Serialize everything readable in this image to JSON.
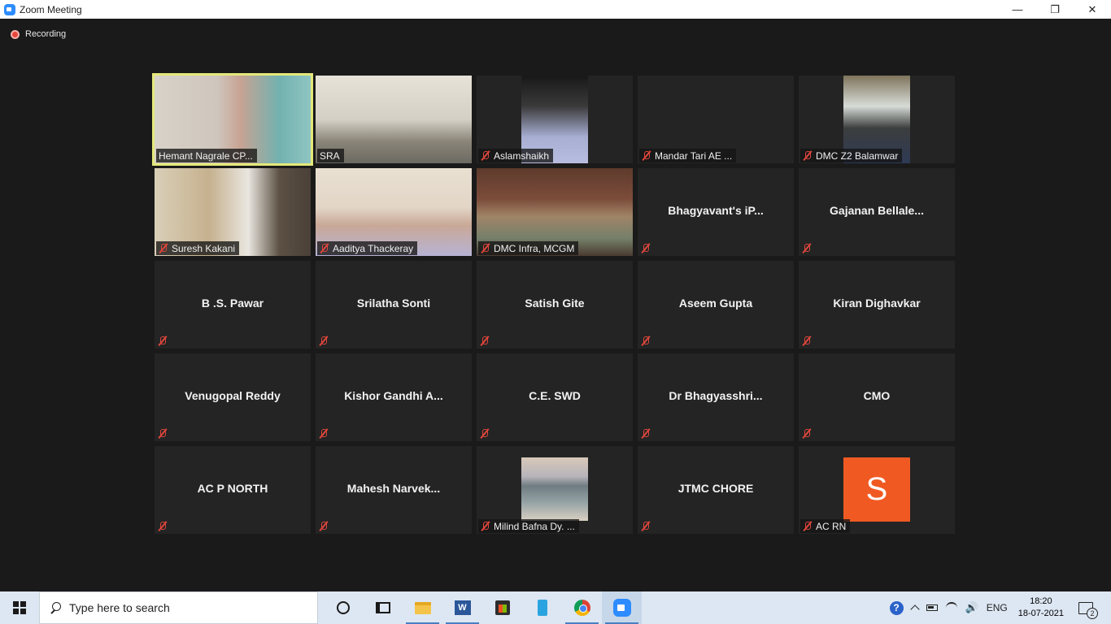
{
  "window": {
    "title": "Zoom Meeting",
    "minimize": "—",
    "restore": "❐",
    "close": "✕"
  },
  "recording": {
    "label": "Recording"
  },
  "participants": [
    {
      "name": "Hemant Nagrale CP...",
      "video": "hemant",
      "muted": false,
      "active": true
    },
    {
      "name": "SRA",
      "video": "sra",
      "muted": false
    },
    {
      "name": "Aslamshaikh",
      "video": "aslam",
      "muted": true
    },
    {
      "name": "Mandar Tari AE ...",
      "video": "none-tag",
      "muted": true
    },
    {
      "name": "DMC Z2 Balamwar",
      "video": "dmcz2",
      "muted": true
    },
    {
      "name": "Suresh Kakani",
      "video": "suresh",
      "muted": true
    },
    {
      "name": "Aaditya Thackeray",
      "video": "aaditya",
      "muted": true
    },
    {
      "name": "DMC Infra, MCGM",
      "video": "dmcinfra",
      "muted": true
    },
    {
      "name": "Bhagyavant's  iP...",
      "video": "none",
      "muted": true
    },
    {
      "name": "Gajanan  Bellale...",
      "video": "none",
      "muted": true
    },
    {
      "name": "B .S. Pawar",
      "video": "none",
      "muted": true
    },
    {
      "name": "Srilatha Sonti",
      "video": "none",
      "muted": true
    },
    {
      "name": "Satish Gite",
      "video": "none",
      "muted": true
    },
    {
      "name": "Aseem Gupta",
      "video": "none",
      "muted": true
    },
    {
      "name": "Kiran Dighavkar",
      "video": "none",
      "muted": true
    },
    {
      "name": "Venugopal Reddy",
      "video": "none",
      "muted": true
    },
    {
      "name": "Kishor Gandhi A...",
      "video": "none",
      "muted": true
    },
    {
      "name": "C.E. SWD",
      "video": "none",
      "muted": true
    },
    {
      "name": "Dr  Bhagyasshri...",
      "video": "none",
      "muted": true
    },
    {
      "name": "CMO",
      "video": "none",
      "muted": true
    },
    {
      "name": "AC P NORTH",
      "video": "none",
      "muted": true
    },
    {
      "name": "Mahesh  Narvek...",
      "video": "none",
      "muted": true
    },
    {
      "name": "Milind Bafna Dy. ...",
      "video": "milind",
      "muted": true
    },
    {
      "name": "JTMC CHORE",
      "video": "none",
      "muted": true
    },
    {
      "name": "AC RN",
      "video": "avatar",
      "avatar_letter": "S",
      "muted": true
    }
  ],
  "taskbar": {
    "search_placeholder": "Type here to search",
    "word_letter": "W",
    "help_label": "?",
    "speaker_glyph": "🔊",
    "language": "ENG",
    "time": "18:20",
    "date": "18-07-2021",
    "notification_count": "2"
  },
  "colors": {
    "active_speaker_border": "#e4e87a",
    "mute_red": "#e0463c",
    "avatar_orange": "#f05a22",
    "meeting_bg": "#1a1a1a",
    "tile_bg": "#242424"
  }
}
